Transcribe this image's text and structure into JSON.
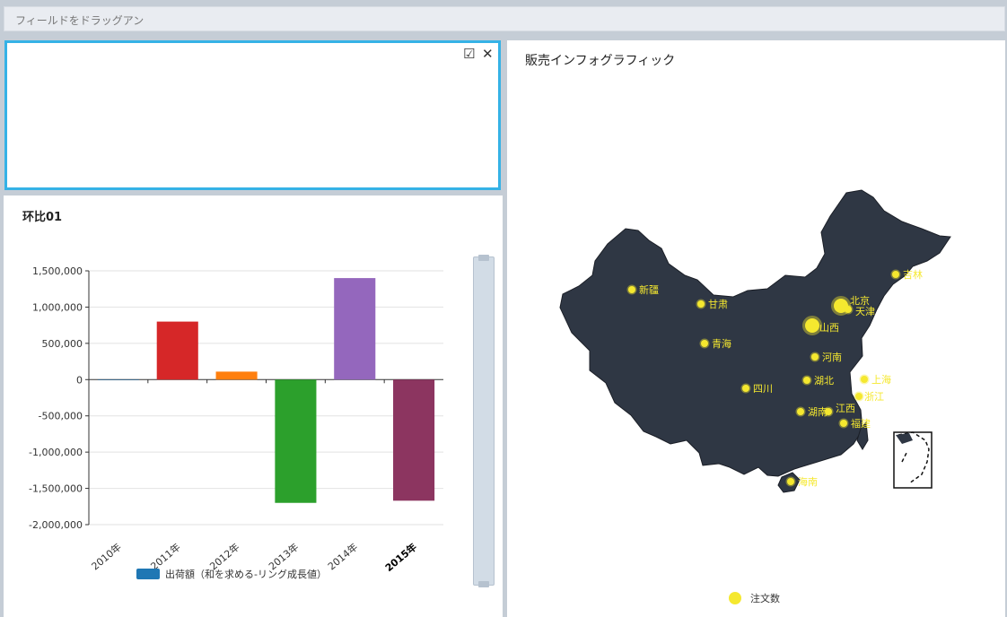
{
  "dropbar": {
    "placeholder": "フィールドをドラッグアン"
  },
  "filter_panel": {
    "check_icon": "☑",
    "close_icon": "✕"
  },
  "chart_panel": {
    "title": "环比01",
    "chart_data": {
      "type": "bar",
      "categories": [
        "2010年",
        "2011年",
        "2012年",
        "2013年",
        "2014年",
        "2015年"
      ],
      "series": [
        {
          "name": "出荷額（和を求める-リング成長値）",
          "values": [
            0,
            800000,
            110000,
            -1700000,
            1400000,
            -1670000
          ]
        }
      ],
      "bar_colors": [
        "#1f77b4",
        "#d62728",
        "#ff7f0e",
        "#2ca02c",
        "#9467bd",
        "#8c3560"
      ],
      "yticks": [
        "1,500,000",
        "1,000,000",
        "500,000",
        "0",
        "-500,000",
        "-1,000,000",
        "-1,500,000",
        "-2,000,000"
      ],
      "ylim": [
        -2000000,
        1500000
      ],
      "legend_color": "#1f77b4",
      "legend_placement": "bottom"
    }
  },
  "map_panel": {
    "title": "販売インフォグラフィック",
    "map_color": "#2f3744",
    "marker_color": "#f5e82f",
    "legend_label": "注文数",
    "labels": [
      "新疆",
      "甘肃",
      "青海",
      "北京",
      "天津",
      "山西",
      "吉林",
      "河南",
      "上海",
      "四川",
      "湖北",
      "浙江",
      "湖南",
      "江西",
      "福建",
      "海南"
    ]
  }
}
